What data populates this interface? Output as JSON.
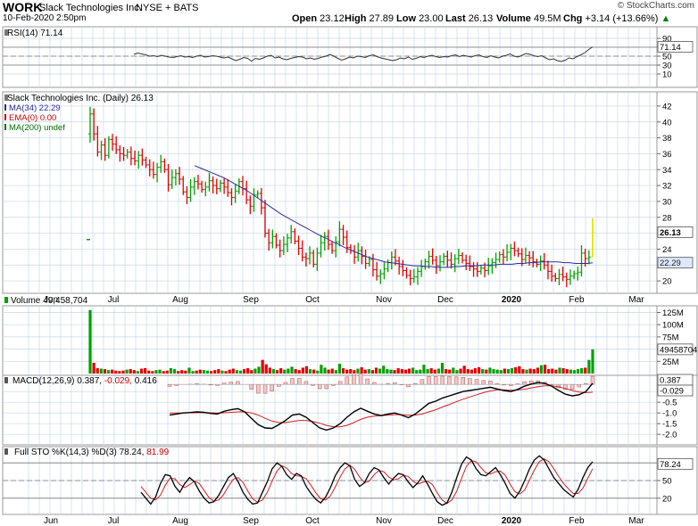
{
  "header": {
    "ticker": "WORK",
    "company": "Slack Technologies Inc.",
    "exchange": "NYSE + BATS",
    "datetime": "10-Feb-2020 2:50pm",
    "credit": "© StockCharts.com",
    "stats": [
      {
        "label": "Open",
        "value": "23.12"
      },
      {
        "label": "High",
        "value": "27.89"
      },
      {
        "label": "Low",
        "value": "23.00"
      },
      {
        "label": "Last",
        "value": "26.13"
      },
      {
        "label": "Volume",
        "value": "49.5M"
      },
      {
        "label": "Chg",
        "value": "+3.14 (+13.66%)",
        "arrow": "▲",
        "color": "#008000"
      }
    ]
  },
  "colors": {
    "up": "#00a000",
    "down": "#e00000",
    "ma34": "#2c2c9c",
    "signal": "#d02020",
    "last": "#e8e800",
    "grid": "#c6d8ea"
  },
  "chart_data": [
    {
      "id": "rsi",
      "type": "line",
      "legend": [
        {
          "text": "RSI(14) 71.14",
          "color": "#000"
        }
      ],
      "y_ticks": [
        "90",
        "70",
        "50",
        "30",
        "10"
      ],
      "ylim": [
        0,
        100
      ],
      "last_value": "71.14",
      "series": [
        {
          "name": "RSI(14)",
          "values": [
            54,
            57,
            55,
            53,
            50,
            51,
            49,
            52,
            50,
            48,
            47,
            49,
            51,
            48,
            49,
            47,
            50,
            52,
            48,
            49,
            51,
            50,
            48,
            46,
            48,
            44,
            40,
            43,
            47,
            45,
            39,
            45,
            43,
            46,
            50,
            52,
            46,
            48,
            44,
            42,
            45,
            47,
            49,
            48,
            44,
            46,
            43,
            45,
            48,
            50,
            54,
            50,
            45,
            41,
            44,
            48,
            46,
            50,
            49,
            47,
            51,
            53,
            49,
            46,
            44,
            42,
            40,
            42,
            46,
            44,
            48,
            43,
            45,
            49,
            47,
            50,
            52,
            49,
            47,
            49,
            48,
            51,
            53,
            49,
            52,
            50,
            48,
            51,
            53,
            49,
            47,
            51,
            48,
            46,
            50,
            52,
            55,
            50,
            48,
            52,
            56,
            54,
            51,
            49,
            51,
            46,
            42,
            44,
            40,
            38,
            41,
            46,
            44,
            49,
            53,
            58,
            65,
            71
          ]
        }
      ]
    },
    {
      "id": "price",
      "type": "ohlc",
      "legend": [
        {
          "text": "Slack Technologies Inc. (Daily) 26.13",
          "color": "#000"
        },
        {
          "text": "MA(34) 22.29",
          "color": "#2c2c9c"
        },
        {
          "text": "EMA(0) 0.00",
          "color": "#c00000"
        },
        {
          "text": "MA(200) undef",
          "color": "#007000"
        }
      ],
      "y_ticks": [
        "42",
        "40",
        "38",
        "36",
        "34",
        "32",
        "30",
        "28",
        "26",
        "24",
        "22",
        "20"
      ],
      "ylim": [
        19,
        43
      ],
      "last_value": "26.13",
      "ma_value": "22.29",
      "x_labels": [
        "Jun",
        "Jul",
        "Aug",
        "Sep",
        "Oct",
        "Nov",
        "Dec",
        "2020",
        "Feb",
        "Mar"
      ],
      "bold_x_labels": [
        "2020"
      ],
      "closes": [
        41.0,
        38.5,
        36.2,
        37.1,
        35.8,
        37.8,
        37.2,
        36.5,
        36.0,
        35.8,
        36.2,
        35.4,
        35.1,
        35.8,
        35.2,
        34.6,
        34.0,
        33.4,
        34.3,
        35.0,
        34.0,
        32.1,
        33.0,
        33.5,
        32.8,
        31.2,
        30.5,
        31.8,
        32.5,
        32.2,
        31.5,
        31.8,
        32.6,
        32.0,
        31.6,
        32.3,
        31.8,
        31.1,
        30.5,
        31.3,
        32.5,
        31.6,
        30.2,
        29.4,
        30.8,
        31.0,
        29.2,
        26.0,
        24.8,
        25.6,
        24.5,
        23.8,
        24.6,
        25.4,
        26.2,
        25.0,
        24.1,
        23.0,
        22.8,
        23.5,
        22.1,
        23.5,
        24.8,
        25.6,
        24.6,
        23.8,
        24.9,
        26.5,
        25.5,
        24.2,
        23.8,
        23.0,
        23.8,
        23.1,
        22.2,
        22.7,
        21.4,
        20.6,
        20.9,
        21.5,
        22.3,
        23.0,
        22.5,
        21.8,
        21.3,
        20.7,
        20.3,
        20.5,
        21.2,
        21.8,
        22.4,
        23.1,
        22.6,
        21.9,
        22.4,
        23.1,
        22.6,
        22.1,
        22.8,
        23.2,
        22.6,
        22.2,
        21.8,
        21.5,
        21.2,
        21.6,
        21.3,
        21.9,
        22.3,
        22.7,
        23.3,
        23.0,
        23.6,
        24.1,
        23.8,
        23.4,
        22.7,
        23.2,
        22.9,
        22.4,
        22.1,
        22.5,
        22.0,
        21.2,
        20.6,
        20.3,
        20.8,
        20.5,
        20.2,
        20.6,
        20.9,
        21.1,
        23.5,
        22.8,
        23.0,
        26.13
      ],
      "ma34": [
        34.5,
        34.2,
        33.9,
        33.6,
        33.3,
        33.0,
        32.6,
        32.2,
        31.8,
        31.4,
        30.9,
        30.4,
        29.9,
        29.4,
        28.9,
        28.4,
        28.0,
        27.6,
        27.2,
        26.8,
        26.4,
        26.0,
        25.6,
        25.3,
        24.9,
        24.6,
        24.2,
        23.9,
        23.6,
        23.3,
        23.0,
        22.8,
        22.6,
        22.4,
        22.3,
        22.2,
        22.1,
        22.0,
        21.9,
        21.9,
        21.8,
        21.8,
        21.7,
        21.7,
        21.7,
        21.8,
        21.8,
        21.9,
        21.9,
        21.9,
        22.0,
        22.0,
        22.0,
        22.1,
        22.1,
        22.1,
        22.2,
        22.2,
        22.3,
        22.3,
        22.4,
        22.4,
        22.4,
        22.4,
        22.3,
        22.3,
        22.2,
        22.2,
        22.2,
        22.29
      ]
    },
    {
      "id": "volume",
      "type": "bar",
      "legend": [
        {
          "text": "Volume 49,458,704",
          "color": "#000"
        }
      ],
      "y_ticks": [
        "125M",
        "100M",
        "75M",
        "50M",
        "25M"
      ],
      "ylim": [
        0,
        135
      ],
      "last_value": "49458704",
      "values": [
        130,
        22,
        11,
        10,
        9,
        7,
        8,
        6,
        5,
        6,
        8,
        9,
        7,
        5,
        10,
        11,
        6,
        5,
        7,
        8,
        5,
        6,
        11,
        9,
        5,
        7,
        6,
        12,
        5,
        6,
        8,
        7,
        6,
        5,
        7,
        9,
        6,
        5,
        8,
        10,
        7,
        6,
        9,
        11,
        7,
        10,
        14,
        28,
        19,
        12,
        9,
        7,
        11,
        8,
        10,
        14,
        9,
        7,
        12,
        15,
        9,
        8,
        6,
        18,
        12,
        8,
        10,
        7,
        20,
        11,
        8,
        9,
        7,
        10,
        13,
        8,
        9,
        7,
        12,
        10,
        16,
        9,
        8,
        7,
        11,
        9,
        8,
        10,
        12,
        7,
        8,
        18,
        9,
        11,
        8,
        10,
        22,
        9,
        8,
        12,
        7,
        10,
        16,
        9,
        8,
        11,
        13,
        9,
        8,
        12,
        9,
        8,
        7,
        10,
        9,
        11,
        13,
        15,
        9,
        8,
        10,
        9,
        12,
        17,
        18,
        9,
        10,
        8,
        12,
        11,
        9,
        8,
        7,
        9,
        11,
        12,
        28,
        49.5
      ]
    },
    {
      "id": "macd",
      "type": "line",
      "legend": [
        {
          "text": "MACD(12,26,9) 0.387, ",
          "color": "#000"
        },
        {
          "text": "-0.029, ",
          "color": "#c00000"
        },
        {
          "text": "0.416",
          "color": "#000"
        }
      ],
      "y_ticks": [
        "0.0",
        "-0.5",
        "-1.0",
        "-1.5",
        "-2.0"
      ],
      "ylim": [
        -2.2,
        0.55
      ],
      "last_values": [
        "0.387",
        "-0.029"
      ],
      "series": [
        {
          "name": "MACD(12,26,9)",
          "values": [
            -1.1,
            -1.05,
            -1.0,
            -0.98,
            -0.95,
            -0.97,
            -1.02,
            -1.05,
            -0.92,
            -0.85,
            -0.8,
            -0.95,
            -1.25,
            -1.55,
            -1.7,
            -1.72,
            -1.55,
            -1.35,
            -1.1,
            -1.05,
            -1.2,
            -1.45,
            -1.7,
            -1.8,
            -1.7,
            -1.5,
            -1.2,
            -0.95,
            -0.78,
            -0.92,
            -1.05,
            -1.12,
            -1.05,
            -1.0,
            -1.1,
            -1.22,
            -1.05,
            -0.8,
            -0.55,
            -0.45,
            -0.3,
            -0.2,
            -0.1,
            0.0,
            0.05,
            0.1,
            0.15,
            0.2,
            0.12,
            0.05,
            0.0,
            0.1,
            0.25,
            0.35,
            0.42,
            0.38,
            0.25,
            0.05,
            -0.12,
            -0.2,
            -0.15,
            0.0,
            0.387
          ]
        },
        {
          "name": "Signal",
          "values": [
            -1.0,
            -1.0,
            -1.0,
            -0.99,
            -0.99,
            -0.98,
            -0.99,
            -1.0,
            -0.99,
            -0.97,
            -0.95,
            -0.95,
            -1.0,
            -1.1,
            -1.25,
            -1.38,
            -1.45,
            -1.45,
            -1.4,
            -1.35,
            -1.35,
            -1.4,
            -1.48,
            -1.58,
            -1.65,
            -1.65,
            -1.58,
            -1.45,
            -1.3,
            -1.2,
            -1.15,
            -1.13,
            -1.1,
            -1.08,
            -1.08,
            -1.1,
            -1.1,
            -1.05,
            -0.95,
            -0.85,
            -0.72,
            -0.6,
            -0.48,
            -0.36,
            -0.25,
            -0.15,
            -0.05,
            0.03,
            0.08,
            0.08,
            0.06,
            0.07,
            0.11,
            0.17,
            0.23,
            0.27,
            0.27,
            0.22,
            0.14,
            0.05,
            -0.02,
            -0.05,
            -0.029
          ]
        }
      ]
    },
    {
      "id": "sto",
      "type": "line",
      "legend": [
        {
          "text": "Full STO %K(14,3) %D(3) 78.24, ",
          "color": "#000"
        },
        {
          "text": "81.99",
          "color": "#c00000"
        }
      ],
      "y_ticks": [
        "50",
        "20"
      ],
      "ylim": [
        0,
        100
      ],
      "last_values": [
        "78.24"
      ],
      "series": [
        {
          "name": "%K(14,3)",
          "values": [
            30,
            20,
            10,
            22,
            45,
            60,
            58,
            40,
            30,
            45,
            55,
            48,
            32,
            20,
            12,
            14,
            25,
            40,
            55,
            62,
            48,
            30,
            18,
            10,
            12,
            30,
            48,
            70,
            80,
            74,
            60,
            52,
            62,
            58,
            40,
            28,
            18,
            12,
            22,
            38,
            58,
            72,
            80,
            75,
            52,
            40,
            46,
            62,
            72,
            68,
            55,
            44,
            54,
            62,
            60,
            48,
            38,
            46,
            58,
            44,
            28,
            14,
            8,
            12,
            30,
            55,
            78,
            90,
            85,
            70,
            60,
            58,
            65,
            72,
            60,
            45,
            28,
            20,
            32,
            50,
            70,
            85,
            92,
            85,
            70,
            55,
            45,
            35,
            28,
            22,
            35,
            55,
            72,
            82
          ]
        },
        {
          "name": "%D(3)",
          "values": [
            40,
            30,
            20,
            17,
            25,
            42,
            54,
            53,
            43,
            38,
            43,
            49,
            45,
            33,
            21,
            15,
            17,
            26,
            40,
            52,
            55,
            47,
            32,
            19,
            13,
            17,
            30,
            49,
            66,
            75,
            71,
            62,
            58,
            57,
            53,
            42,
            29,
            19,
            17,
            24,
            39,
            56,
            70,
            76,
            69,
            56,
            46,
            49,
            60,
            67,
            65,
            56,
            51,
            53,
            59,
            57,
            49,
            44,
            47,
            49,
            43,
            29,
            17,
            11,
            17,
            32,
            54,
            74,
            84,
            82,
            72,
            63,
            61,
            65,
            66,
            59,
            44,
            31,
            27,
            34,
            51,
            68,
            82,
            87,
            82,
            70,
            57,
            45,
            36,
            28,
            28,
            37,
            54,
            70
          ]
        }
      ]
    }
  ]
}
